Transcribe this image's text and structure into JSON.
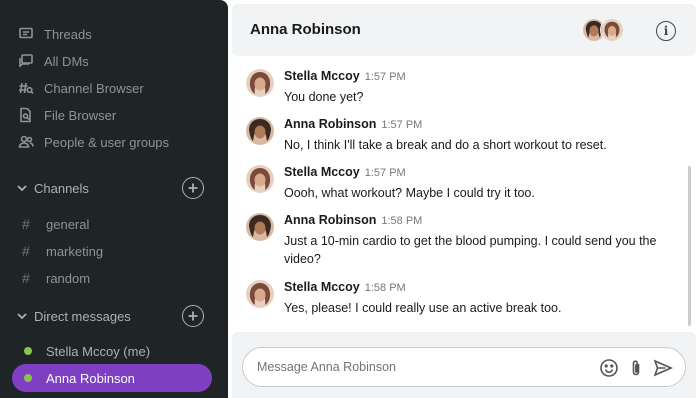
{
  "sidebar": {
    "nav": [
      {
        "label": "Threads",
        "icon": "threads-icon"
      },
      {
        "label": "All DMs",
        "icon": "all-dms-icon"
      },
      {
        "label": "Channel Browser",
        "icon": "channel-browser-icon"
      },
      {
        "label": "File Browser",
        "icon": "file-browser-icon"
      },
      {
        "label": "People & user groups",
        "icon": "people-icon"
      }
    ],
    "channels_label": "Channels",
    "channels": [
      "general",
      "marketing",
      "random"
    ],
    "dms_label": "Direct messages",
    "dms": [
      {
        "label": "Stella Mccoy (me)",
        "active": false
      },
      {
        "label": "Anna Robinson",
        "active": true
      }
    ],
    "colors": {
      "bg": "#1f2527",
      "active": "#7e3fc2",
      "online": "#8bc34a"
    }
  },
  "header": {
    "title": "Anna Robinson"
  },
  "messages": [
    {
      "name": "Stella Mccoy",
      "time": "1:57 PM",
      "text": "You done yet?",
      "avatar": "stella"
    },
    {
      "name": "Anna Robinson",
      "time": "1:57 PM",
      "text": "No, I think I'll take a break and do a short workout to reset.",
      "avatar": "anna"
    },
    {
      "name": "Stella Mccoy",
      "time": "1:57 PM",
      "text": "Oooh, what workout? Maybe I could try it too.",
      "avatar": "stella"
    },
    {
      "name": "Anna Robinson",
      "time": "1:58 PM",
      "text": "Just a 10-min cardio to get the blood pumping. I could send you the video?",
      "avatar": "anna"
    },
    {
      "name": "Stella Mccoy",
      "time": "1:58 PM",
      "text": "Yes, please! I could really use an active break too.",
      "avatar": "stella"
    }
  ],
  "composer": {
    "placeholder": "Message Anna Robinson"
  }
}
